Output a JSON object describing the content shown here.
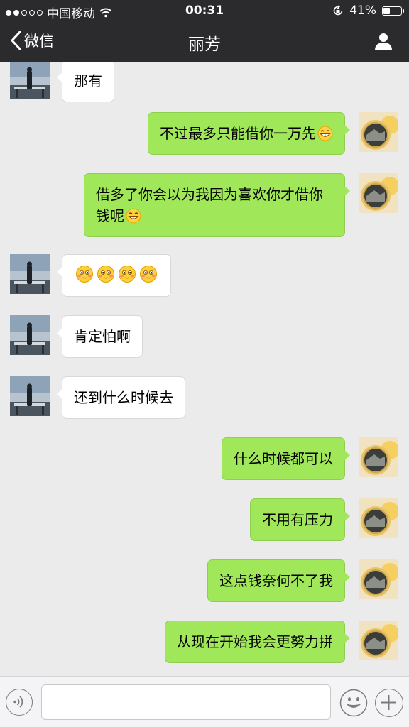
{
  "status_bar": {
    "carrier": "中国移动",
    "time": "00:31",
    "battery": "41%",
    "battery_level": 0.41
  },
  "nav": {
    "back_label": "微信",
    "title": "丽芳"
  },
  "messages": [
    {
      "side": "left",
      "text": "那有",
      "emoji_count": 0
    },
    {
      "side": "right",
      "text": "不过最多只能借你一万先",
      "emoji_count": 1
    },
    {
      "side": "right",
      "text": "借多了你会以为我因为喜欢你才借你钱呢",
      "emoji_count": 1
    },
    {
      "side": "left",
      "text": "",
      "emoji_count": 4,
      "emoji_style": "shy"
    },
    {
      "side": "left",
      "text": "肯定怕啊",
      "emoji_count": 0
    },
    {
      "side": "left",
      "text": "还到什么时候去",
      "emoji_count": 0
    },
    {
      "side": "right",
      "text": "什么时候都可以",
      "emoji_count": 0
    },
    {
      "side": "right",
      "text": "不用有压力",
      "emoji_count": 0
    },
    {
      "side": "right",
      "text": "这点钱奈何不了我",
      "emoji_count": 0
    },
    {
      "side": "right",
      "text": "从现在开始我会更努力拼",
      "emoji_count": 0
    }
  ],
  "input": {
    "value": "",
    "placeholder": ""
  },
  "icons": {
    "back": "chevron-left-icon",
    "profile": "person-icon",
    "voice": "voice-icon",
    "emoji": "emoji-icon",
    "plus": "plus-icon"
  },
  "colors": {
    "bar_bg": "#2b2b2e",
    "chat_bg": "#ebebeb",
    "sent_bubble": "#a0e759",
    "received_bubble": "#ffffff"
  }
}
